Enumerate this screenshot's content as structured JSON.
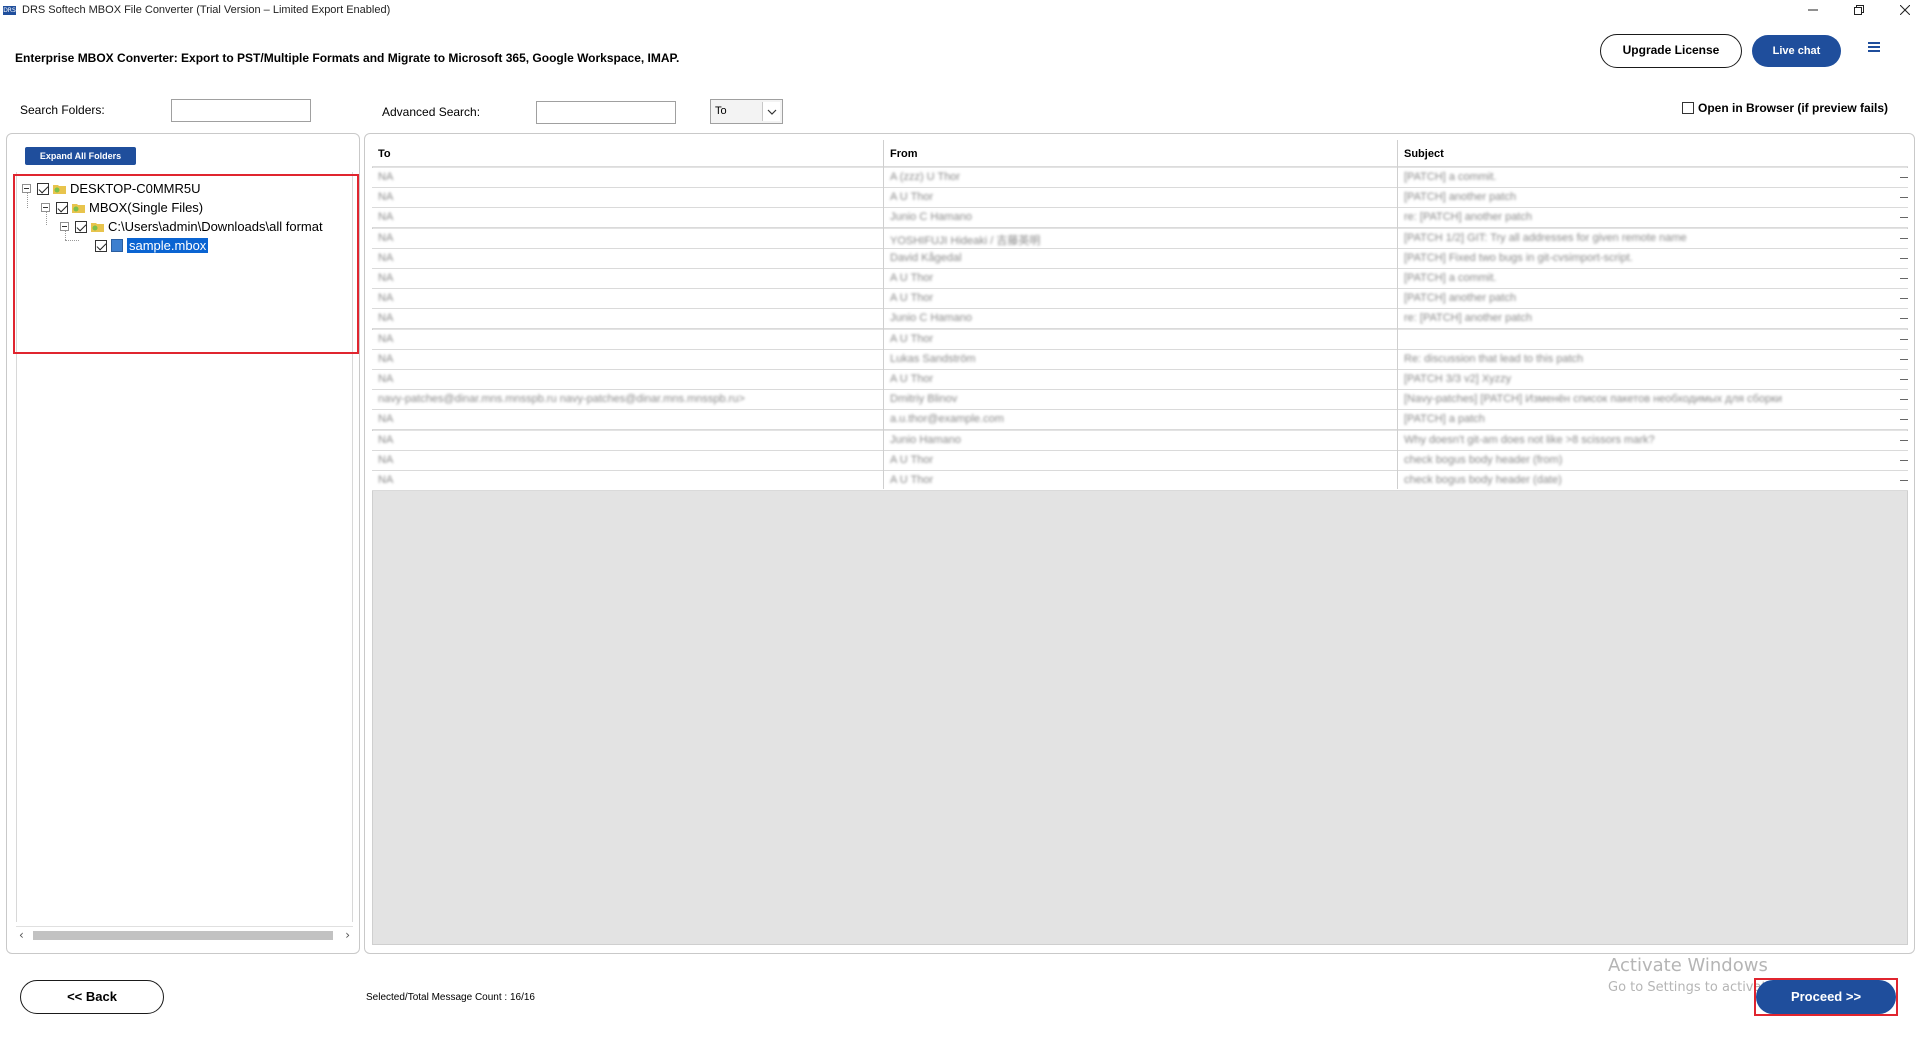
{
  "window": {
    "icon_text": "DRS",
    "title": "DRS Softech MBOX File Converter (Trial Version – Limited Export Enabled)",
    "minimize": "–",
    "restore": "❐",
    "close": "✕"
  },
  "header": {
    "heading": "Enterprise MBOX Converter: Export to PST/Multiple Formats and Migrate to Microsoft 365, Google Workspace, IMAP.",
    "upgrade_label": "Upgrade License",
    "livechat_label": "Live chat"
  },
  "search": {
    "folders_label": "Search Folders:",
    "folders_value": "",
    "advanced_label": "Advanced Search:",
    "advanced_value": "",
    "field_selected": "To",
    "open_browser_label": "Open in Browser (if preview fails)",
    "open_browser_checked": false
  },
  "tree": {
    "expand_all_label": "Expand All Folders",
    "nodes": [
      {
        "label": "DESKTOP-C0MMR5U",
        "checked": true
      },
      {
        "label": "MBOX(Single Files)",
        "checked": true
      },
      {
        "label": "C:\\Users\\admin\\Downloads\\all format",
        "checked": true
      },
      {
        "label": "sample.mbox",
        "checked": true,
        "selected": true
      }
    ]
  },
  "grid": {
    "columns": [
      "To",
      "From",
      "Subject"
    ],
    "rows": [
      [
        "NA",
        "A (zzz) U Thor",
        "[PATCH] a commit."
      ],
      [
        "NA",
        "A U Thor",
        "[PATCH] another patch"
      ],
      [
        "NA",
        "Junio C Hamano",
        "re: [PATCH] another patch"
      ],
      [
        "NA",
        "YOSHIFUJI Hideaki / 吉藤英明",
        "[PATCH 1/2] GIT: Try all addresses for given remote name"
      ],
      [
        "NA",
        "David Kågedal",
        "[PATCH] Fixed two bugs in git-cvsimport-script."
      ],
      [
        "NA",
        "A U Thor",
        "[PATCH] a commit."
      ],
      [
        "NA",
        "A U Thor",
        "[PATCH] another patch"
      ],
      [
        "NA",
        "Junio C Hamano",
        "re: [PATCH] another patch"
      ],
      [
        "NA",
        "A U Thor",
        ""
      ],
      [
        "NA",
        "Lukas Sandström",
        "Re: discussion that lead to this patch"
      ],
      [
        "NA",
        "A U Thor",
        "[PATCH 3/3 v2] Xyzzy"
      ],
      [
        "navy-patches@dinar.mns.mnsspb.ru navy-patches@dinar.mns.mnsspb.ru>",
        "Dmitriy Blinov",
        "[Navy-patches] [PATCH] Изменён список пакетов необходимых для сборки"
      ],
      [
        "NA",
        "a.u.thor@example.com",
        "[PATCH] a patch"
      ],
      [
        "NA",
        "Junio Hamano",
        "Why doesn't git-am does not like >8 scissors mark?"
      ],
      [
        "NA",
        "A U Thor",
        "check bogus body header (from)"
      ],
      [
        "NA",
        "A U Thor",
        "check bogus body header (date)"
      ]
    ]
  },
  "footer": {
    "back_label": "<< Back",
    "count_label": "Selected/Total Message Count : 16/16",
    "proceed_label": "Proceed >>",
    "watermark_title": "Activate Windows",
    "watermark_sub": "Go to Settings to activate Windows."
  }
}
